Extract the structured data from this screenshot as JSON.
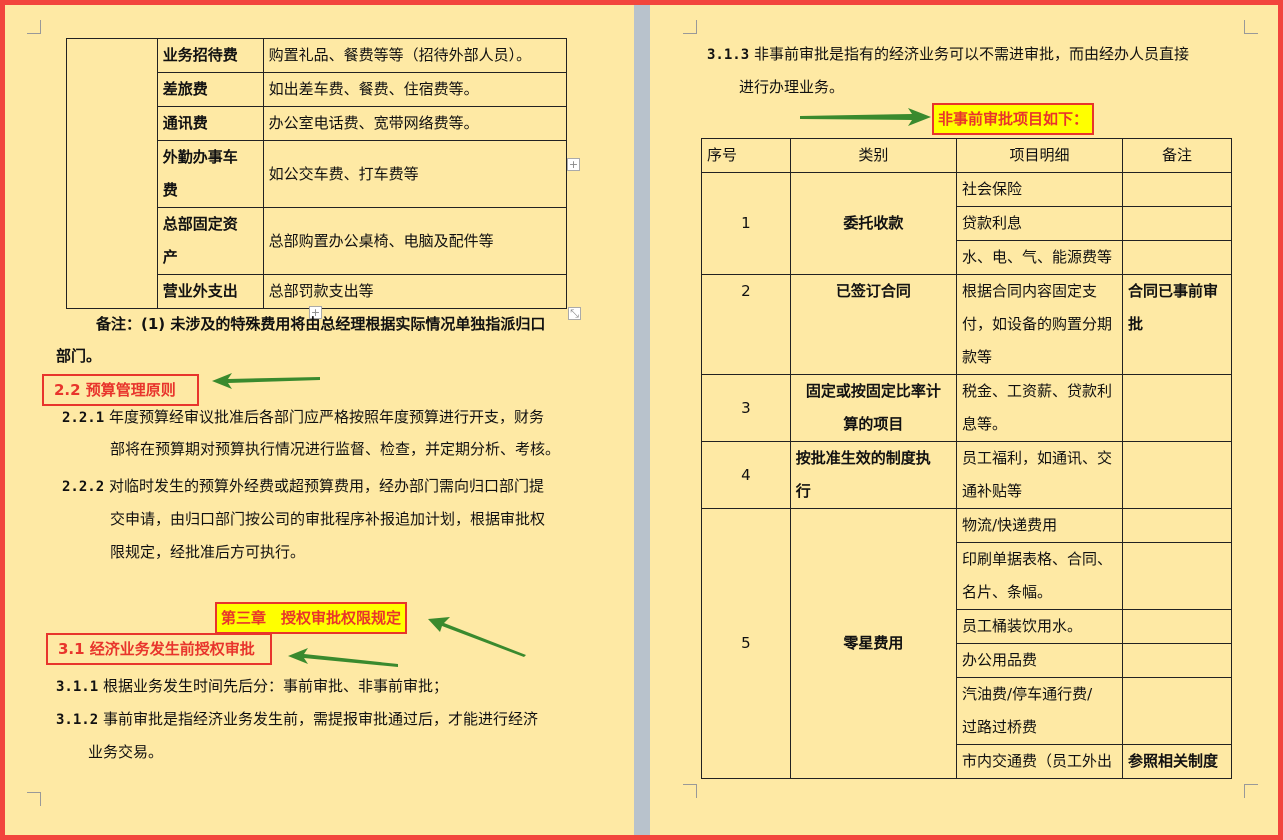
{
  "left_table": {
    "rows": [
      {
        "category": "业务招待费",
        "detail": "购置礼品、餐费等等（招待外部人员）。"
      },
      {
        "category": "差旅费",
        "detail": "如出差车费、餐费、住宿费等。"
      },
      {
        "category": "通讯费",
        "detail": "办公室电话费、宽带网络费等。"
      },
      {
        "category": "外勤办事车费",
        "category_line1": "外勤办事车",
        "category_line2": "费",
        "detail": "如公交车费、打车费等"
      },
      {
        "category": "总部固定资产",
        "category_line1": "总部固定资",
        "category_line2": "产",
        "detail": "总部购置办公桌椅、电脑及配件等"
      },
      {
        "category": "营业外支出",
        "detail": "总部罚款支出等"
      }
    ]
  },
  "left": {
    "note_line1": "备注：(1) 未涉及的特殊费用将由总经理根据实际情况单独指派归口",
    "note_line2": "部门。",
    "heading_2_2": "2.2 预算管理原则",
    "p221_num": "2.2.1",
    "p221_line1": "年度预算经审议批准后各部门应严格按照年度预算进行开支，财务",
    "p221_line2": "部将在预算期对预算执行情况进行监督、检查，并定期分析、考核。",
    "p222_num": "2.2.2",
    "p222_line1": "对临时发生的预算外经费或超预算费用，经办部门需向归口部门提",
    "p222_line2": "交申请，由归口部门按公司的审批程序补报追加计划，根据审批权",
    "p222_line3": "限规定，经批准后方可执行。",
    "chapter3": "第三章　授权审批权限规定",
    "heading_3_1": "3.1 经济业务发生前授权审批",
    "p311_num": "3.1.1",
    "p311_text": "根据业务发生时间先后分：事前审批、非事前审批；",
    "p312_num": "3.1.2",
    "p312_line1": "事前审批是指经济业务发生前，需提报审批通过后，才能进行经济",
    "p312_line2": "业务交易。"
  },
  "right": {
    "p313_num": "3.1.3",
    "p313_line1": "非事前审批是指有的经济业务可以不需进审批，而由经办人员直接",
    "p313_line2": "进行办理业务。",
    "callout": "非事前审批项目如下：",
    "headers": [
      "序号",
      "类别",
      "项目明细",
      "备注"
    ],
    "groups": [
      {
        "no": "1",
        "category": "委托收款",
        "items": [
          "社会保险",
          "贷款利息",
          "水、电、气、能源费等"
        ],
        "note": ""
      },
      {
        "no": "2",
        "category": "已签订合同",
        "items_lines": [
          "根据合同内容固定支",
          "付，如设备的购置分期",
          "款等"
        ],
        "note_lines": [
          "合同已事前审",
          "批"
        ]
      },
      {
        "no": "3",
        "category_lines": [
          "固定或按固定比率计",
          "算的项目"
        ],
        "items_lines": [
          "税金、工资薪、贷款利",
          "息等。"
        ],
        "note": ""
      },
      {
        "no": "4",
        "category_lines": [
          "按批准生效的制度执",
          "行"
        ],
        "items_lines": [
          "员工福利，如通讯、交",
          "通补贴等"
        ],
        "note": ""
      },
      {
        "no": "5",
        "category": "零星费用",
        "items": [
          "物流/快递费用",
          "印刷单据表格、合同、名片、条幅。",
          "员工桶装饮用水。",
          "办公用品费",
          "汽油费/停车通行费/过路过桥费",
          "市内交通费（员工外出"
        ],
        "last_note": "参照相关制度"
      }
    ],
    "g5_item2_lines": [
      "印刷单据表格、合同、",
      "名片、条幅。"
    ],
    "g5_item5_lines": [
      "汽油费/停车通行费/",
      "过路过桥费"
    ]
  },
  "colors": {
    "page_bg": "#fee9a4",
    "frame": "#f2453d",
    "highlight": "#ffff00",
    "heading_red": "#e8352c",
    "arrow_green": "#3a8a2e"
  }
}
